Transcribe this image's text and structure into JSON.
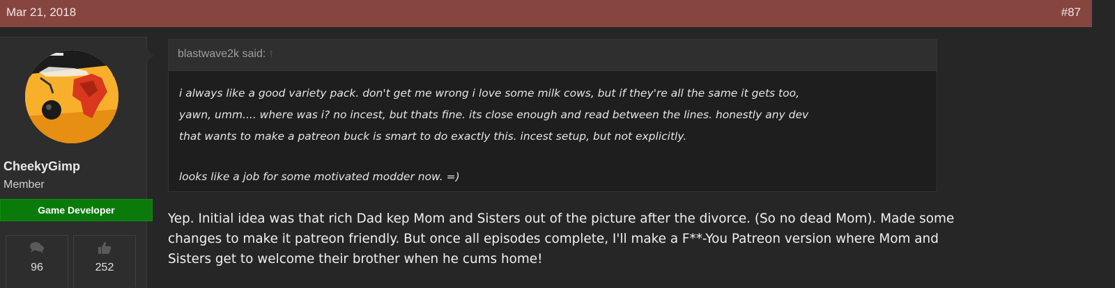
{
  "post": {
    "date": "Mar 21, 2018",
    "number": "#87"
  },
  "user": {
    "name": "CheekyGimp",
    "title": "Member",
    "banner": "Game Developer",
    "stats": {
      "messages": "96",
      "reactions": "252"
    },
    "icons": {
      "messages": "speech-bubbles-icon",
      "reactions": "thumbs-up-icon"
    }
  },
  "quote": {
    "author_label": "blastwave2k said:",
    "arrow": "↑",
    "lines": [
      "i always like a good variety pack. don't get me wrong i love some milk cows, but if they're all the same it gets too,",
      "yawn, umm.... where was i? no incest, but thats fine. its close enough and read between the lines. honestly any dev",
      "that wants to make a patreon buck is smart to do exactly this. incest setup, but not explicitly."
    ],
    "last_line": "looks like a job for some motivated modder now. =)"
  },
  "message": {
    "lines": [
      "Yep. Initial idea was that rich Dad kep Mom and Sisters out of the picture after the divorce. (So no dead Mom). Made some",
      "changes to make it patreon friendly. But once all episodes complete, I'll make a F**-You Patreon version where Mom and",
      "Sisters get to welcome their brother when he cums home!"
    ]
  },
  "colors": {
    "header_bg": "#874540",
    "page_bg": "#262626",
    "banner_bg": "#0a7a0a",
    "quote_bg": "#1e1e1e"
  }
}
